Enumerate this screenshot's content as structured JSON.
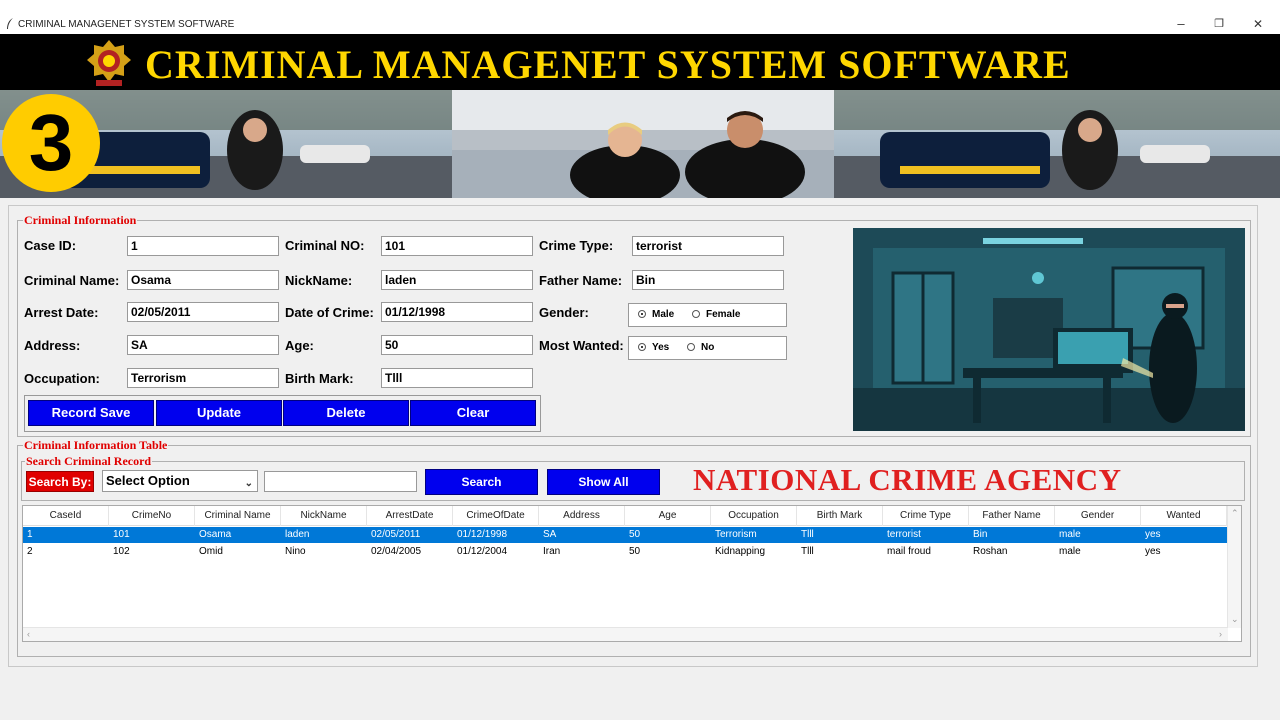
{
  "window": {
    "title": "CRIMINAL MANAGENET SYSTEM SOFTWARE",
    "minimize": "–",
    "restore": "❐",
    "close": "✕"
  },
  "header": {
    "title": "CRIMINAL MANAGENET SYSTEM SOFTWARE"
  },
  "step_badge": "3",
  "criminal_info": {
    "legend": "Criminal Information",
    "fields": {
      "case_id": {
        "label": "Case ID:",
        "value": "1"
      },
      "criminal_no": {
        "label": "Criminal NO:",
        "value": "101"
      },
      "crime_type": {
        "label": "Crime Type:",
        "value": "terrorist"
      },
      "criminal_name": {
        "label": "Criminal Name:",
        "value": "Osama"
      },
      "nickname": {
        "label": "NickName:",
        "value": "laden"
      },
      "father_name": {
        "label": "Father Name:",
        "value": "Bin"
      },
      "arrest_date": {
        "label": "Arrest Date:",
        "value": "02/05/2011"
      },
      "date_of_crime": {
        "label": "Date of Crime:",
        "value": "01/12/1998"
      },
      "address": {
        "label": "Address:",
        "value": "SA"
      },
      "age": {
        "label": "Age:",
        "value": "50"
      },
      "occupation": {
        "label": "Occupation:",
        "value": "Terrorism"
      },
      "birth_mark": {
        "label": "Birth Mark:",
        "value": "Tlll"
      }
    },
    "gender": {
      "label": "Gender:",
      "options": [
        "Male",
        "Female"
      ],
      "selected": "Male"
    },
    "most_wanted": {
      "label": "Most Wanted:",
      "options": [
        "Yes",
        "No"
      ],
      "selected": "Yes"
    },
    "buttons": {
      "save": "Record Save",
      "update": "Update",
      "delete": "Delete",
      "clear": "Clear"
    }
  },
  "table_section": {
    "legend": "Criminal Information Table",
    "search_legend": "Search Criminal Record",
    "search_by_label": "Search By:",
    "select_value": "Select Option",
    "search_text": "",
    "search_button": "Search",
    "show_all_button": "Show All",
    "agency": "NATIONAL CRIME AGENCY"
  },
  "table": {
    "columns": [
      "CaseId",
      "CrimeNo",
      "Criminal Name",
      "NickName",
      "ArrestDate",
      "CrimeOfDate",
      "Address",
      "Age",
      "Occupation",
      "Birth Mark",
      "Crime Type",
      "Father Name",
      "Gender",
      "Wanted"
    ],
    "rows": [
      [
        "1",
        "101",
        "Osama",
        "laden",
        "02/05/2011",
        "01/12/1998",
        "SA",
        "50",
        "Terrorism",
        "Tlll",
        "terrorist",
        "Bin",
        "male",
        "yes"
      ],
      [
        "2",
        "102",
        "Omid",
        "Nino",
        "02/04/2005",
        "01/12/2004",
        "Iran",
        "50",
        "Kidnapping",
        "Tlll",
        "mail froud",
        "Roshan",
        "male",
        "yes"
      ]
    ],
    "selected_row": 0
  },
  "colors": {
    "header_bg": "#000000",
    "header_text": "#ffd700",
    "accent_red": "#e00000",
    "button_blue": "#0000ee",
    "selection": "#0078d7"
  }
}
